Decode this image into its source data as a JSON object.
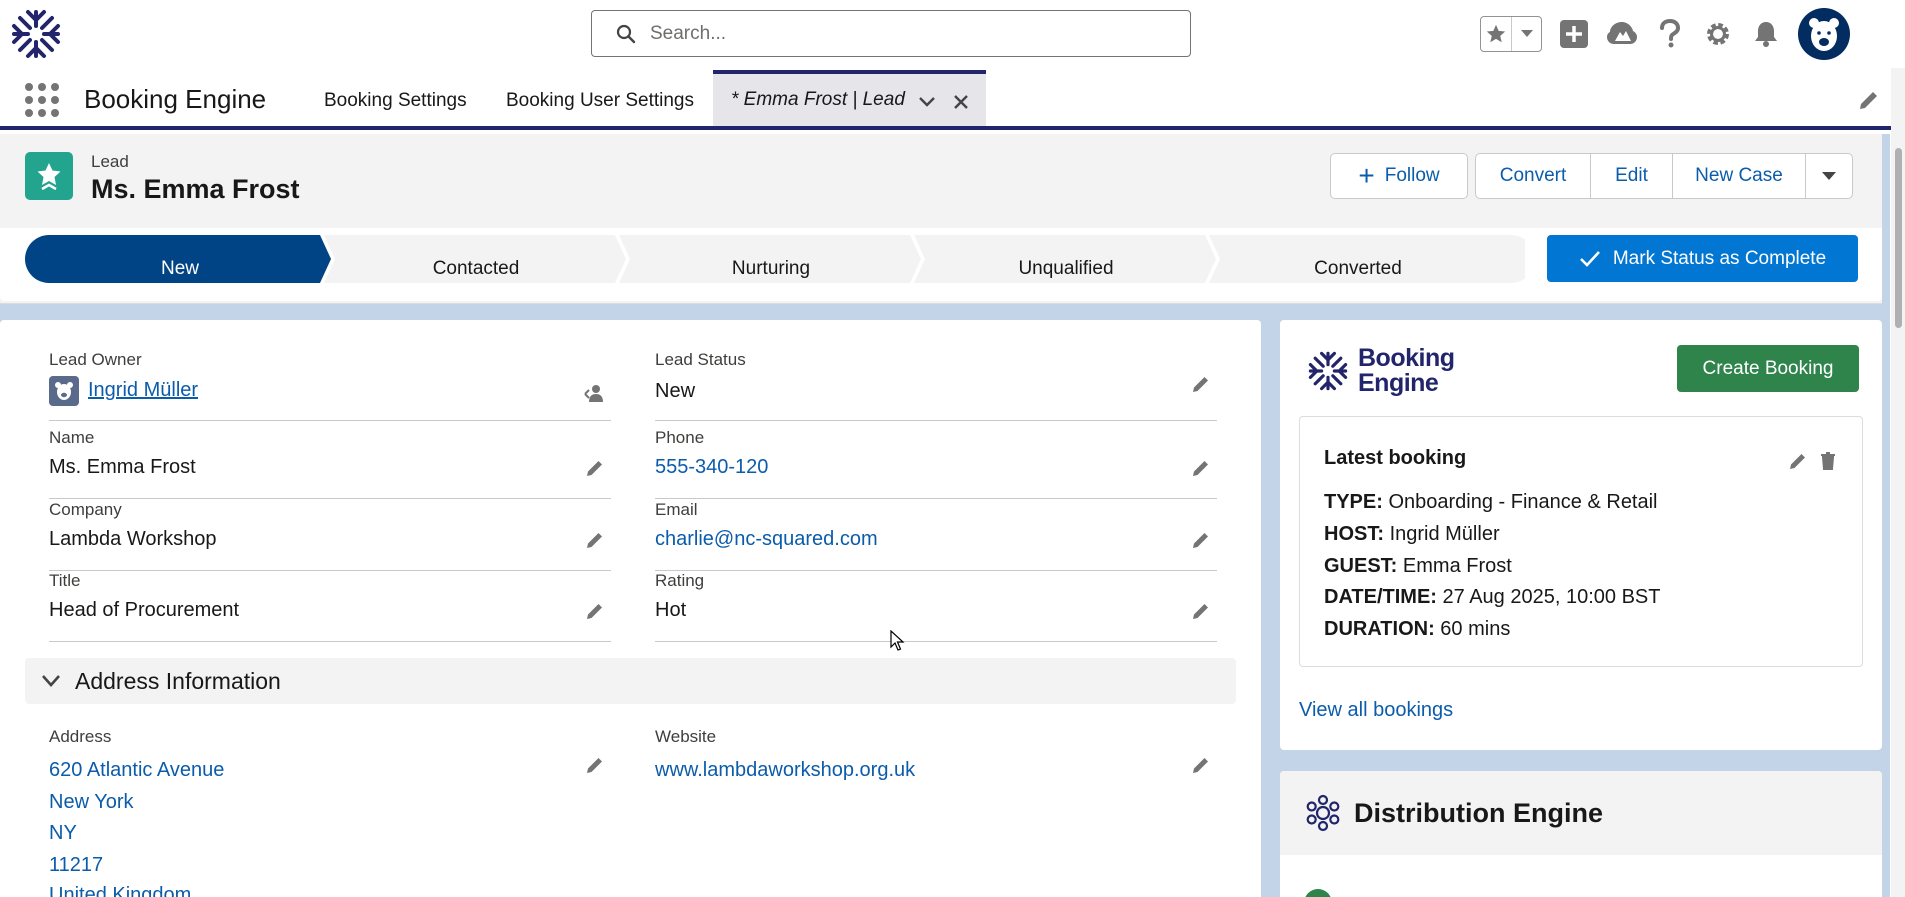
{
  "global_header": {
    "search_placeholder": "Search...",
    "icons": [
      "app-logo-icon",
      "search-icon",
      "star-icon",
      "chevron-down-icon",
      "add-icon",
      "trailhead-icon",
      "help-icon",
      "setup-gear-icon",
      "notification-bell-icon",
      "user-avatar"
    ]
  },
  "app_nav": {
    "app_name": "Booking Engine",
    "items": [
      {
        "label": "Booking Settings"
      },
      {
        "label": "Booking User Settings"
      }
    ],
    "active_tab": {
      "label": "* Emma Frost | Lead"
    }
  },
  "record": {
    "type": "Lead",
    "name": "Ms. Emma Frost",
    "actions": {
      "follow": "Follow",
      "convert": "Convert",
      "edit": "Edit",
      "new_case": "New Case"
    }
  },
  "path": {
    "stages": [
      "New",
      "Contacted",
      "Nurturing",
      "Unqualified",
      "Converted"
    ],
    "current": "New",
    "mark_complete": "Mark Status as Complete"
  },
  "details": {
    "lead_owner": {
      "label": "Lead Owner",
      "value": "Ingrid Müller"
    },
    "lead_status": {
      "label": "Lead Status",
      "value": "New"
    },
    "name": {
      "label": "Name",
      "value": "Ms. Emma Frost"
    },
    "phone": {
      "label": "Phone",
      "value": "555-340-120"
    },
    "company": {
      "label": "Company",
      "value": "Lambda Workshop"
    },
    "email": {
      "label": "Email",
      "value": "charlie@nc-squared.com"
    },
    "title": {
      "label": "Title",
      "value": "Head of Procurement"
    },
    "rating": {
      "label": "Rating",
      "value": "Hot"
    }
  },
  "address_section": {
    "title": "Address Information",
    "address_label": "Address",
    "address_lines": [
      "620 Atlantic Avenue",
      "New York",
      "NY",
      "11217",
      "United Kingdom"
    ],
    "website_label": "Website",
    "website_value": "www.lambdaworkshop.org.uk"
  },
  "booking_widget": {
    "logo_line1": "Booking",
    "logo_line2": "Engine",
    "create_button": "Create Booking",
    "latest_title": "Latest booking",
    "rows": [
      {
        "key": "TYPE:",
        "value": "Onboarding - Finance & Retail"
      },
      {
        "key": "HOST:",
        "value": "Ingrid Müller"
      },
      {
        "key": "GUEST:",
        "value": "Emma Frost"
      },
      {
        "key": "DATE/TIME:",
        "value": "27 Aug 2025, 10:00 BST"
      },
      {
        "key": "DURATION:",
        "value": "60 mins"
      }
    ],
    "view_all": "View all bookings"
  },
  "distribution_widget": {
    "title": "Distribution Engine"
  },
  "colors": {
    "brand_navy": "#22256b",
    "path_current": "#014486",
    "primary_button": "#0176d3",
    "create_button": "#2e844a",
    "lead_icon": "#22a48f",
    "link": "#0b5cab"
  }
}
